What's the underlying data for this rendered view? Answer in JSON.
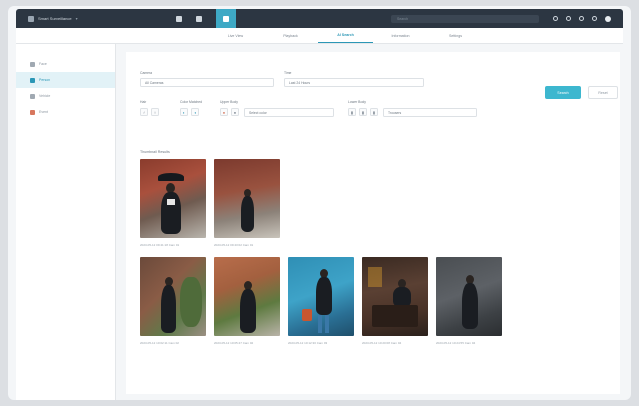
{
  "brand": {
    "name": "Smart Surveillance",
    "caret": "▾"
  },
  "search": {
    "placeholder": "Search"
  },
  "subtabs": [
    {
      "label": "Live View"
    },
    {
      "label": "Playback"
    },
    {
      "label": "AI Search"
    },
    {
      "label": "Information"
    },
    {
      "label": "Settings"
    }
  ],
  "sidebar": {
    "items": [
      {
        "label": "Face"
      },
      {
        "label": "Person"
      },
      {
        "label": "Vehicle"
      },
      {
        "label": "Event"
      }
    ]
  },
  "form": {
    "camera_label": "Camera",
    "camera_value": "All Cameras",
    "time_label": "Time",
    "time_value": "Last 24 Hours",
    "hair_label": "Hair",
    "color_label": "Color Matched",
    "upper_label": "Upper Body",
    "upper_value": "Select color",
    "lower_label": "Lower Body",
    "lower_value": "Trousers",
    "search_button": "Search",
    "reset_button": "Reset"
  },
  "results": {
    "title": "Thumbnail Results",
    "row1": [
      {
        "caption": "2023-05-12 09:41:18 Cam 01"
      },
      {
        "caption": "2023-05-12 09:43:02 Cam 01"
      }
    ],
    "row2": [
      {
        "caption": "2023-05-12 10:02:11 Cam 02"
      },
      {
        "caption": "2023-05-12 10:05:47 Cam 02"
      },
      {
        "caption": "2023-05-12 10:12:30 Cam 03"
      },
      {
        "caption": "2023-05-12 10:20:08 Cam 04"
      },
      {
        "caption": "2023-05-12 10:24:55 Cam 04"
      }
    ]
  },
  "colors": {
    "topbar": "#2c3642",
    "accent": "#3db7cf",
    "active_tab": "#2b97b6"
  }
}
